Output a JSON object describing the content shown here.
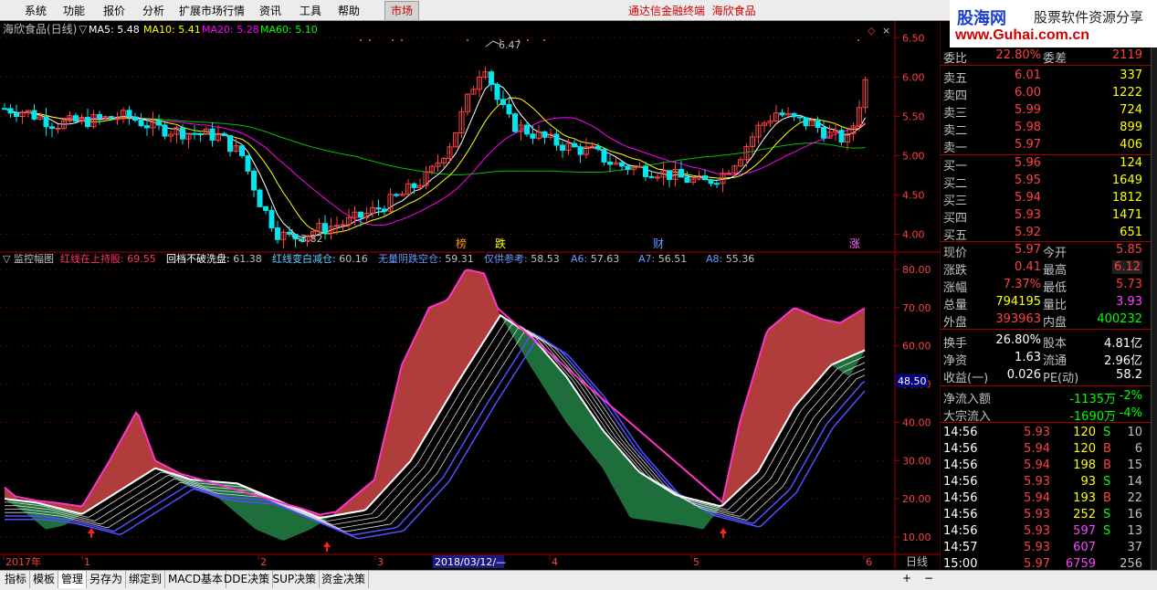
{
  "menu": [
    "系统",
    "功能",
    "报价",
    "分析",
    "扩展市场行情",
    "资讯",
    "工具",
    "帮助"
  ],
  "market_button": "市场",
  "app_title": "通达信金融终端",
  "stock_name": "海欣食品",
  "brand": {
    "line1": "股海网",
    "line2": "股票软件资源分享",
    "line3": "www.Guhai.com.cn"
  },
  "price_panel": {
    "name": "海欣食品(日线)",
    "ma": [
      {
        "label": "MA5: 5.48",
        "color": "#ffffff"
      },
      {
        "label": "MA10: 5.41",
        "color": "#ffff00"
      },
      {
        "label": "MA20: 5.28",
        "color": "#ff00ff"
      },
      {
        "label": "MA60: 5.10",
        "color": "#00ff00"
      }
    ],
    "y_ticks": [
      "6.50",
      "6.00",
      "5.50",
      "5.00",
      "4.50",
      "4.00"
    ],
    "high_label": "6.47",
    "low_label": "3.82",
    "markers": [
      {
        "text": "榜",
        "color": "#ff9900"
      },
      {
        "text": "跌",
        "color": "#ffff00"
      },
      {
        "text": "财",
        "color": "#6699ff"
      },
      {
        "text": "涨",
        "color": "#ff66ff"
      }
    ]
  },
  "indicator_panel": {
    "name": "监控幅图",
    "items": [
      {
        "label": "红线在上持股:",
        "value": "69.55",
        "color": "#ff3366"
      },
      {
        "label": "回档不破洗盘:",
        "value": "61.38",
        "color": "#ffffff"
      },
      {
        "label": "红线变白减仓:",
        "value": "60.16",
        "color": "#66ccff"
      },
      {
        "label": "无量阴跌空仓:",
        "value": "59.31",
        "color": "#6699ff"
      },
      {
        "label": "仅供参考:",
        "value": "58.53",
        "color": "#6699ff"
      },
      {
        "label": "A6:",
        "value": "57.63",
        "color": "#6699ff"
      },
      {
        "label": "A7:",
        "value": "56.51",
        "color": "#6699ff"
      },
      {
        "label": "A8:",
        "value": "55.36",
        "color": "#6699ff"
      }
    ],
    "y_ticks": [
      "80.00",
      "70.00",
      "60.00",
      "50.00",
      "40.00",
      "30.00",
      "20.00",
      "10.00"
    ],
    "current_value": "48.50"
  },
  "x_axis": {
    "labels": [
      "2017年",
      "1",
      "2",
      "3",
      "4",
      "5",
      "6"
    ],
    "cursor_date": "2018/03/12/—",
    "period": "日线"
  },
  "quote": {
    "weibi": {
      "label": "委比",
      "value": "22.80%",
      "label2": "委差",
      "value2": "2119"
    },
    "asks": [
      {
        "label": "卖五",
        "price": "6.01",
        "vol": "337"
      },
      {
        "label": "卖四",
        "price": "6.00",
        "vol": "1222"
      },
      {
        "label": "卖三",
        "price": "5.99",
        "vol": "724"
      },
      {
        "label": "卖二",
        "price": "5.98",
        "vol": "899"
      },
      {
        "label": "卖一",
        "price": "5.97",
        "vol": "406"
      }
    ],
    "bids": [
      {
        "label": "买一",
        "price": "5.96",
        "vol": "124"
      },
      {
        "label": "买二",
        "price": "5.95",
        "vol": "1649"
      },
      {
        "label": "买三",
        "price": "5.94",
        "vol": "1812"
      },
      {
        "label": "买四",
        "price": "5.93",
        "vol": "1471"
      },
      {
        "label": "买五",
        "price": "5.92",
        "vol": "651"
      }
    ],
    "stats": [
      {
        "l1": "现价",
        "v1": "5.97",
        "c1": "#ff4040",
        "l2": "今开",
        "v2": "5.85",
        "c2": "#ff4040"
      },
      {
        "l1": "涨跌",
        "v1": "0.41",
        "c1": "#ff4040",
        "l2": "最高",
        "v2": "6.12",
        "c2": "#ff4040"
      },
      {
        "l1": "涨幅",
        "v1": "7.37%",
        "c1": "#ff4040",
        "l2": "最低",
        "v2": "5.73",
        "c2": "#ff4040"
      },
      {
        "l1": "总量",
        "v1": "794195",
        "c1": "#ffff00",
        "l2": "量比",
        "v2": "3.93",
        "c2": "#ff44ff"
      },
      {
        "l1": "外盘",
        "v1": "393963",
        "c1": "#ff4040",
        "l2": "内盘",
        "v2": "400232",
        "c2": "#00ff00"
      },
      {
        "l1": "换手",
        "v1": "26.80%",
        "c1": "#ffffff",
        "l2": "股本",
        "v2": "4.81亿",
        "c2": "#ffffff"
      },
      {
        "l1": "净资",
        "v1": "1.63",
        "c1": "#ffffff",
        "l2": "流通",
        "v2": "2.96亿",
        "c2": "#ffffff"
      },
      {
        "l1": "收益(一)",
        "v1": "0.026",
        "c1": "#ffffff",
        "l2": "PE(动)",
        "v2": "58.2",
        "c2": "#ffffff"
      }
    ],
    "flows": [
      {
        "label": "净流入额",
        "value": "-1135万",
        "pct": "-2%"
      },
      {
        "label": "大宗流入",
        "value": "-1690万",
        "pct": "-4%"
      }
    ],
    "ticks": [
      {
        "time": "14:56",
        "price": "5.93",
        "vol": "120",
        "side": "S",
        "num": "10"
      },
      {
        "time": "14:56",
        "price": "5.94",
        "vol": "120",
        "side": "B",
        "num": "6"
      },
      {
        "time": "14:56",
        "price": "5.94",
        "vol": "198",
        "side": "B",
        "num": "15"
      },
      {
        "time": "14:56",
        "price": "5.93",
        "vol": "93",
        "side": "S",
        "num": "14"
      },
      {
        "time": "14:56",
        "price": "5.94",
        "vol": "193",
        "side": "B",
        "num": "22"
      },
      {
        "time": "14:56",
        "price": "5.93",
        "vol": "252",
        "side": "S",
        "num": "16"
      },
      {
        "time": "14:56",
        "price": "5.93",
        "vol": "597",
        "side": "S",
        "num": "13"
      },
      {
        "time": "14:57",
        "price": "5.93",
        "vol": "607",
        "side": "",
        "num": "37"
      },
      {
        "time": "15:00",
        "price": "5.97",
        "vol": "6759",
        "side": "",
        "num": "256"
      }
    ]
  },
  "bottom_tabs": [
    "指标",
    "模板",
    "管理",
    "另存为",
    "绑定到",
    "MACD基本",
    "DDE决策",
    "SUP决策",
    "资金决策"
  ],
  "bottom_controls": [
    "+",
    "−"
  ],
  "colors": {
    "grid_red": "#a00000",
    "up_red": "#ff4040",
    "down_cyan": "#00e5ee",
    "red_fill": "#b03c3c",
    "green_fill": "#1e6e3c"
  }
}
